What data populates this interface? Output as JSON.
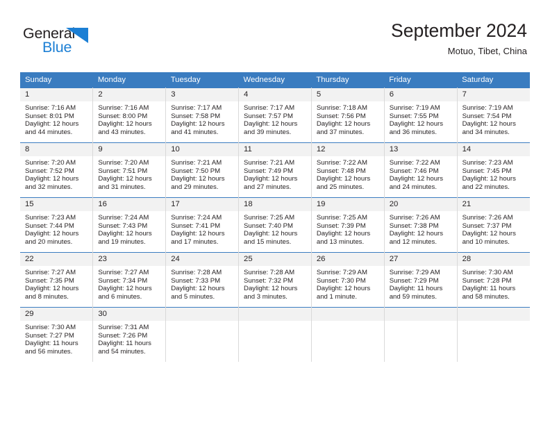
{
  "logo": {
    "word_one": "General",
    "word_two": "Blue",
    "triangle_color": "#1c7fd4",
    "blue_color": "#1c7fd4",
    "dark_color": "#231f20"
  },
  "header": {
    "title": "September 2024",
    "location": "Motuo, Tibet, China"
  },
  "theme": {
    "header_row_bg": "#3a7cc0",
    "day_number_bg": "#f2f2f2",
    "cell_border": "#d9d9d9",
    "text": "#231f20"
  },
  "weekday_headers": [
    "Sunday",
    "Monday",
    "Tuesday",
    "Wednesday",
    "Thursday",
    "Friday",
    "Saturday"
  ],
  "weeks": [
    [
      {
        "day": "1",
        "sunrise": "Sunrise: 7:16 AM",
        "sunset": "Sunset: 8:01 PM",
        "daylight": "Daylight: 12 hours and 44 minutes."
      },
      {
        "day": "2",
        "sunrise": "Sunrise: 7:16 AM",
        "sunset": "Sunset: 8:00 PM",
        "daylight": "Daylight: 12 hours and 43 minutes."
      },
      {
        "day": "3",
        "sunrise": "Sunrise: 7:17 AM",
        "sunset": "Sunset: 7:58 PM",
        "daylight": "Daylight: 12 hours and 41 minutes."
      },
      {
        "day": "4",
        "sunrise": "Sunrise: 7:17 AM",
        "sunset": "Sunset: 7:57 PM",
        "daylight": "Daylight: 12 hours and 39 minutes."
      },
      {
        "day": "5",
        "sunrise": "Sunrise: 7:18 AM",
        "sunset": "Sunset: 7:56 PM",
        "daylight": "Daylight: 12 hours and 37 minutes."
      },
      {
        "day": "6",
        "sunrise": "Sunrise: 7:19 AM",
        "sunset": "Sunset: 7:55 PM",
        "daylight": "Daylight: 12 hours and 36 minutes."
      },
      {
        "day": "7",
        "sunrise": "Sunrise: 7:19 AM",
        "sunset": "Sunset: 7:54 PM",
        "daylight": "Daylight: 12 hours and 34 minutes."
      }
    ],
    [
      {
        "day": "8",
        "sunrise": "Sunrise: 7:20 AM",
        "sunset": "Sunset: 7:52 PM",
        "daylight": "Daylight: 12 hours and 32 minutes."
      },
      {
        "day": "9",
        "sunrise": "Sunrise: 7:20 AM",
        "sunset": "Sunset: 7:51 PM",
        "daylight": "Daylight: 12 hours and 31 minutes."
      },
      {
        "day": "10",
        "sunrise": "Sunrise: 7:21 AM",
        "sunset": "Sunset: 7:50 PM",
        "daylight": "Daylight: 12 hours and 29 minutes."
      },
      {
        "day": "11",
        "sunrise": "Sunrise: 7:21 AM",
        "sunset": "Sunset: 7:49 PM",
        "daylight": "Daylight: 12 hours and 27 minutes."
      },
      {
        "day": "12",
        "sunrise": "Sunrise: 7:22 AM",
        "sunset": "Sunset: 7:48 PM",
        "daylight": "Daylight: 12 hours and 25 minutes."
      },
      {
        "day": "13",
        "sunrise": "Sunrise: 7:22 AM",
        "sunset": "Sunset: 7:46 PM",
        "daylight": "Daylight: 12 hours and 24 minutes."
      },
      {
        "day": "14",
        "sunrise": "Sunrise: 7:23 AM",
        "sunset": "Sunset: 7:45 PM",
        "daylight": "Daylight: 12 hours and 22 minutes."
      }
    ],
    [
      {
        "day": "15",
        "sunrise": "Sunrise: 7:23 AM",
        "sunset": "Sunset: 7:44 PM",
        "daylight": "Daylight: 12 hours and 20 minutes."
      },
      {
        "day": "16",
        "sunrise": "Sunrise: 7:24 AM",
        "sunset": "Sunset: 7:43 PM",
        "daylight": "Daylight: 12 hours and 19 minutes."
      },
      {
        "day": "17",
        "sunrise": "Sunrise: 7:24 AM",
        "sunset": "Sunset: 7:41 PM",
        "daylight": "Daylight: 12 hours and 17 minutes."
      },
      {
        "day": "18",
        "sunrise": "Sunrise: 7:25 AM",
        "sunset": "Sunset: 7:40 PM",
        "daylight": "Daylight: 12 hours and 15 minutes."
      },
      {
        "day": "19",
        "sunrise": "Sunrise: 7:25 AM",
        "sunset": "Sunset: 7:39 PM",
        "daylight": "Daylight: 12 hours and 13 minutes."
      },
      {
        "day": "20",
        "sunrise": "Sunrise: 7:26 AM",
        "sunset": "Sunset: 7:38 PM",
        "daylight": "Daylight: 12 hours and 12 minutes."
      },
      {
        "day": "21",
        "sunrise": "Sunrise: 7:26 AM",
        "sunset": "Sunset: 7:37 PM",
        "daylight": "Daylight: 12 hours and 10 minutes."
      }
    ],
    [
      {
        "day": "22",
        "sunrise": "Sunrise: 7:27 AM",
        "sunset": "Sunset: 7:35 PM",
        "daylight": "Daylight: 12 hours and 8 minutes."
      },
      {
        "day": "23",
        "sunrise": "Sunrise: 7:27 AM",
        "sunset": "Sunset: 7:34 PM",
        "daylight": "Daylight: 12 hours and 6 minutes."
      },
      {
        "day": "24",
        "sunrise": "Sunrise: 7:28 AM",
        "sunset": "Sunset: 7:33 PM",
        "daylight": "Daylight: 12 hours and 5 minutes."
      },
      {
        "day": "25",
        "sunrise": "Sunrise: 7:28 AM",
        "sunset": "Sunset: 7:32 PM",
        "daylight": "Daylight: 12 hours and 3 minutes."
      },
      {
        "day": "26",
        "sunrise": "Sunrise: 7:29 AM",
        "sunset": "Sunset: 7:30 PM",
        "daylight": "Daylight: 12 hours and 1 minute."
      },
      {
        "day": "27",
        "sunrise": "Sunrise: 7:29 AM",
        "sunset": "Sunset: 7:29 PM",
        "daylight": "Daylight: 11 hours and 59 minutes."
      },
      {
        "day": "28",
        "sunrise": "Sunrise: 7:30 AM",
        "sunset": "Sunset: 7:28 PM",
        "daylight": "Daylight: 11 hours and 58 minutes."
      }
    ],
    [
      {
        "day": "29",
        "sunrise": "Sunrise: 7:30 AM",
        "sunset": "Sunset: 7:27 PM",
        "daylight": "Daylight: 11 hours and 56 minutes."
      },
      {
        "day": "30",
        "sunrise": "Sunrise: 7:31 AM",
        "sunset": "Sunset: 7:26 PM",
        "daylight": "Daylight: 11 hours and 54 minutes."
      },
      {
        "day": "",
        "sunrise": "",
        "sunset": "",
        "daylight": ""
      },
      {
        "day": "",
        "sunrise": "",
        "sunset": "",
        "daylight": ""
      },
      {
        "day": "",
        "sunrise": "",
        "sunset": "",
        "daylight": ""
      },
      {
        "day": "",
        "sunrise": "",
        "sunset": "",
        "daylight": ""
      },
      {
        "day": "",
        "sunrise": "",
        "sunset": "",
        "daylight": ""
      }
    ]
  ]
}
